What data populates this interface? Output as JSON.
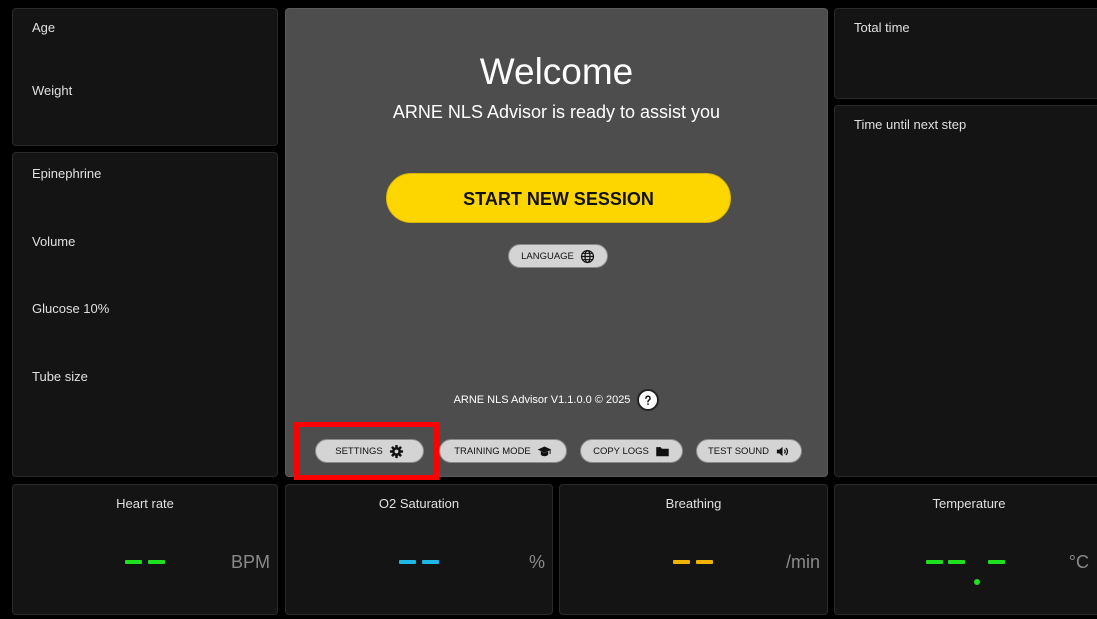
{
  "patient": {
    "age_label": "Age",
    "weight_label": "Weight"
  },
  "drugs": {
    "epinephrine_label": "Epinephrine",
    "volume_label": "Volume",
    "glucose_label": "Glucose 10%",
    "tube_label": "Tube size"
  },
  "center": {
    "title": "Welcome",
    "subtitle": "ARNE NLS Advisor is ready to assist you",
    "start_label": "START NEW SESSION",
    "language_label": "LANGUAGE",
    "version_text": "ARNE NLS Advisor V1.1.0.0 © 2025",
    "settings_label": "SETTINGS",
    "training_label": "TRAINING MODE",
    "copylogs_label": "COPY LOGS",
    "testsound_label": "TEST SOUND"
  },
  "timers": {
    "total_label": "Total time",
    "next_label": "Time until next step"
  },
  "vitals": {
    "hr": {
      "title": "Heart rate",
      "unit": "BPM",
      "color": "#1fe01f"
    },
    "o2": {
      "title": "O2 Saturation",
      "unit": "%",
      "color": "#1fb8e6"
    },
    "br": {
      "title": "Breathing",
      "unit": "/min",
      "color": "#f2b200"
    },
    "temp": {
      "title": "Temperature",
      "unit": "°C",
      "color": "#1fe01f"
    }
  },
  "colors": {
    "accent": "#fdd600",
    "highlight": "#ff0000",
    "background": "#000000"
  },
  "icons": [
    "globe-icon",
    "help-icon",
    "gear-icon",
    "graduation-cap-icon",
    "folder-icon",
    "speaker-icon"
  ]
}
